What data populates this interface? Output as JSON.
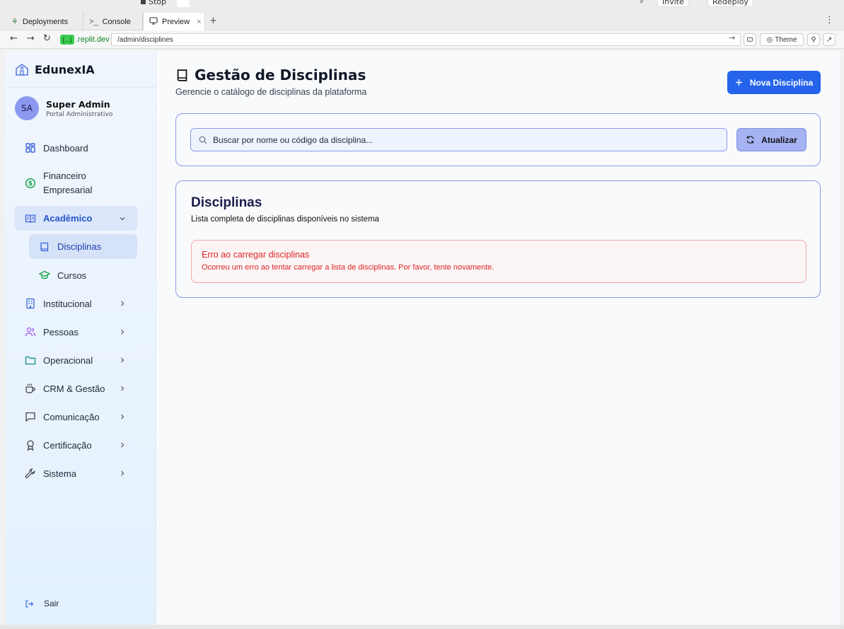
{
  "browser": {
    "top": {
      "stop_label": "Stop",
      "invite_label": "Invite",
      "redeploy_label": "Redeploy"
    },
    "tabs": [
      {
        "label": "Deployments",
        "icon": "tree-icon"
      },
      {
        "label": "Console",
        "icon": "terminal-icon"
      },
      {
        "label": "Preview",
        "icon": "monitor-icon"
      }
    ],
    "domain": ".replit.dev",
    "domain_chip": "{...}",
    "path": "/admin/disciplines",
    "theme_label": "Theme"
  },
  "sidebar": {
    "brand": "EdunexIA",
    "user": {
      "initials": "SA",
      "name": "Super Admin",
      "role": "Portal Administrativo"
    },
    "items": [
      {
        "label": "Dashboard"
      },
      {
        "label": "Financeiro",
        "label2": "Empresarial"
      },
      {
        "label": "Acadêmico"
      },
      {
        "label": "Disciplinas"
      },
      {
        "label": "Cursos"
      },
      {
        "label": "Institucional"
      },
      {
        "label": "Pessoas"
      },
      {
        "label": "Operacional"
      },
      {
        "label": "CRM & Gestão"
      },
      {
        "label": "Comunicação"
      },
      {
        "label": "Certificação"
      },
      {
        "label": "Sistema"
      }
    ],
    "logout": "Sair"
  },
  "main": {
    "title": "Gestão de Disciplinas",
    "subtitle": "Gerencie o catálogo de disciplinas da plataforma",
    "new_button": "Nova Disciplina",
    "search_placeholder": "Buscar por nome ou código da disciplina...",
    "refresh_button": "Atualizar",
    "card_title": "Disciplinas",
    "card_subtitle": "Lista completa de disciplinas disponíveis no sistema",
    "error_title": "Erro ao carregar disciplinas",
    "error_message": "Ocorreu um erro ao tentar carregar a lista de disciplinas. Por favor, tente novamente."
  },
  "colors": {
    "primary": "#2563eb",
    "error": "#dc2626",
    "card_border": "#8a9ae6"
  }
}
